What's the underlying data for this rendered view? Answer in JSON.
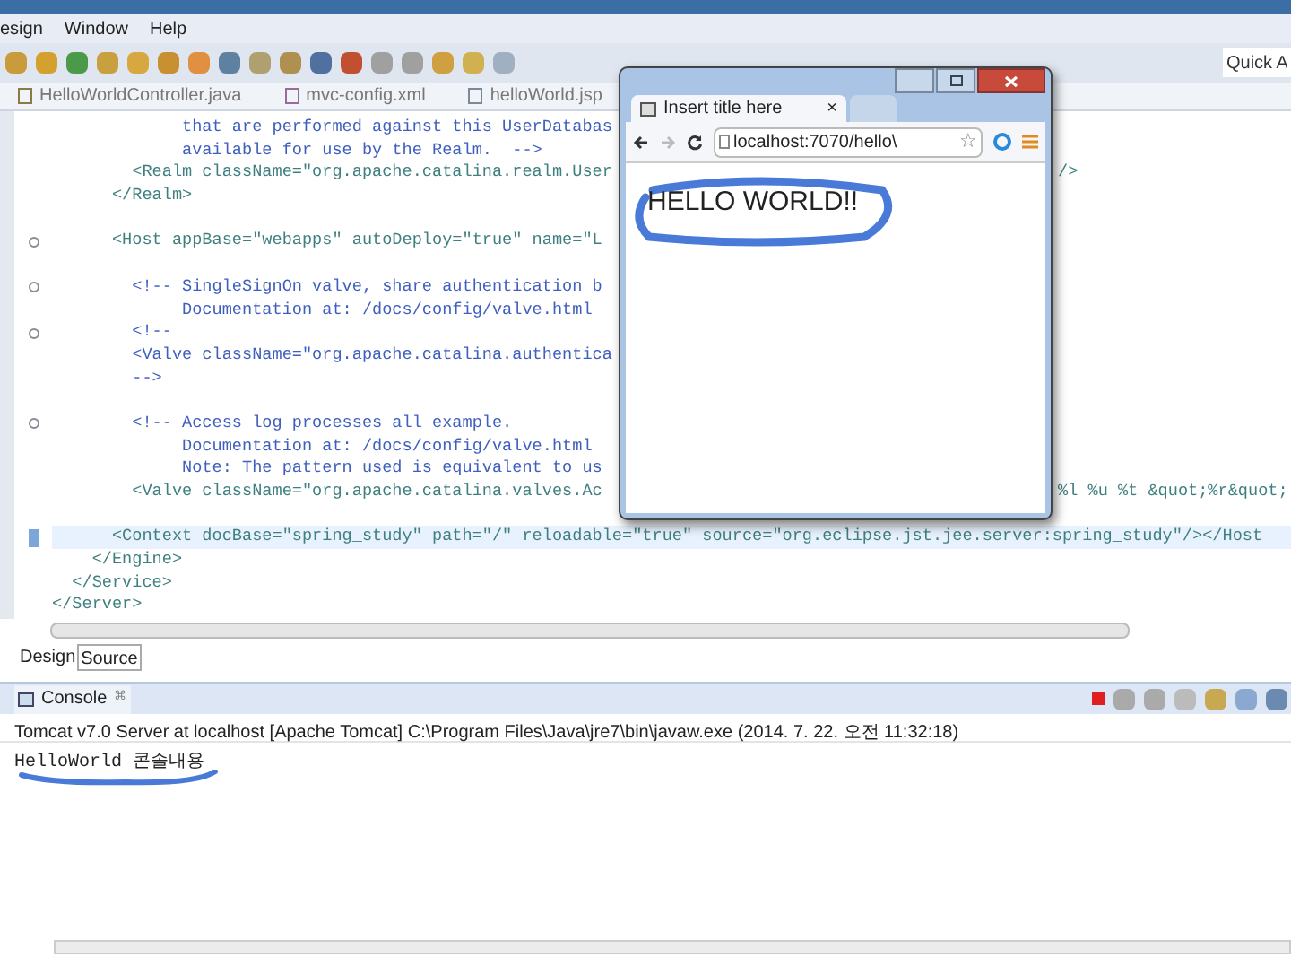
{
  "menu_bar": [
    "esign",
    "Window",
    "Help"
  ],
  "quick_access": {
    "placeholder": "Quick A"
  },
  "editor_tabs": [
    {
      "label": "HelloWorldController.java",
      "selected": false,
      "kind": "java"
    },
    {
      "label": "mvc-config.xml",
      "selected": false,
      "kind": "xml"
    },
    {
      "label": "helloWorld.jsp",
      "selected": false,
      "kind": "jsp"
    }
  ],
  "code_lines": [
    {
      "text": "             that are performed against this UserDatabas",
      "kind": "comment"
    },
    {
      "text": "             available for use by the Realm.  -->",
      "kind": "comment"
    },
    {
      "text": "        <Realm className=\"org.apache.catalina.realm.User",
      "kind": "tag",
      "tail": "/>"
    },
    {
      "text": "      </Realm>",
      "kind": "tag"
    },
    {
      "kind": "blank"
    },
    {
      "text": "      <Host appBase=\"webapps\" autoDeploy=\"true\" name=\"L",
      "kind": "tag",
      "fold": true
    },
    {
      "kind": "blank"
    },
    {
      "text": "        <!-- SingleSignOn valve, share authentication b",
      "kind": "comment",
      "fold": true
    },
    {
      "text": "             Documentation at: /docs/config/valve.html",
      "kind": "comment"
    },
    {
      "text": "        <!--",
      "kind": "comment",
      "fold": true
    },
    {
      "text": "        <Valve className=\"org.apache.catalina.authentica",
      "kind": "comment"
    },
    {
      "text": "        -->",
      "kind": "comment"
    },
    {
      "kind": "blank"
    },
    {
      "text": "        <!-- Access log processes all example.",
      "kind": "comment",
      "fold": true
    },
    {
      "text": "             Documentation at: /docs/config/valve.html",
      "kind": "comment"
    },
    {
      "text": "             Note: The pattern used is equivalent to us",
      "kind": "comment"
    },
    {
      "text": "        <Valve className=\"org.apache.catalina.valves.Ac",
      "kind": "tag",
      "tail": "%l %u %t &quot;%r&quot;"
    },
    {
      "kind": "blank"
    },
    {
      "text": "      <Context docBase=\"spring_study\" path=\"/\" reloadable=\"true\" source=\"org.eclipse.jst.jee.server:spring_study\"/></Host",
      "kind": "tag",
      "current": true
    },
    {
      "text": "    </Engine>",
      "kind": "tag"
    },
    {
      "text": "  </Service>",
      "kind": "tag"
    },
    {
      "text": "</Server>",
      "kind": "tag"
    }
  ],
  "view_tabs": [
    {
      "label": "Design",
      "selected": false
    },
    {
      "label": "Source",
      "selected": true
    }
  ],
  "console": {
    "title": "Console",
    "close": "⌘",
    "header": "Tomcat v7.0 Server at localhost [Apache Tomcat] C:\\Program Files\\Java\\jre7\\bin\\javaw.exe (2014. 7. 22. 오전 11:32:18)",
    "output": "HelloWorld 콘솔내용"
  },
  "browser": {
    "tabs": [
      {
        "label": "Insert title here",
        "close": "×",
        "selected": true
      },
      {
        "selected": false
      }
    ],
    "url": "localhost:7070/hello\\",
    "star": "☆",
    "page_text": "HELLO WORLD!!"
  }
}
